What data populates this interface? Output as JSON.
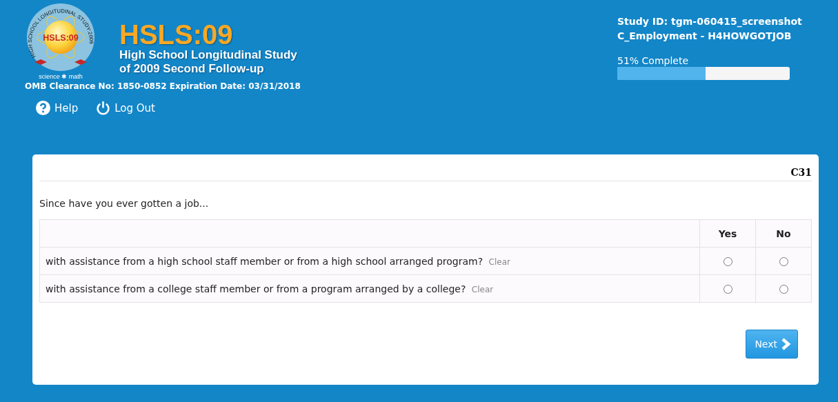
{
  "logo": {
    "center": "HSLS:09",
    "ring": "HIGH SCHOOL LONGITUDINAL STUDY:2009",
    "motto": "science ✱ math"
  },
  "title": "HSLS:09",
  "subtitle": [
    "High School Longitudinal Study",
    "of 2009 Second Follow-up"
  ],
  "omb": "OMB Clearance No: 1850-0852 Expiration Date: 03/31/2018",
  "nav": [
    {
      "kind": "help",
      "label": "Help"
    },
    {
      "kind": "logout",
      "label": "Log Out"
    }
  ],
  "study": {
    "id": "Study ID: tgm-060415_screenshot",
    "section": "C_Employment - H4HOWGOTJOB"
  },
  "progress": {
    "label": "51% Complete",
    "level": 0.51
  },
  "question": {
    "number": "C31",
    "text": "Since have you ever gotten a job...",
    "columns": [
      "Yes",
      "No"
    ],
    "rows": [
      {
        "text": "with assistance from a high school staff member or from a high school arranged program?",
        "clear": "Clear",
        "answers": [
          {
            "selected": false
          },
          {
            "selected": false
          }
        ]
      },
      {
        "text": "with assistance from a college staff member or from a program arranged by a college?",
        "clear": "Clear",
        "answers": [
          {
            "selected": false
          },
          {
            "selected": false
          }
        ]
      }
    ]
  },
  "next_button": "Next"
}
